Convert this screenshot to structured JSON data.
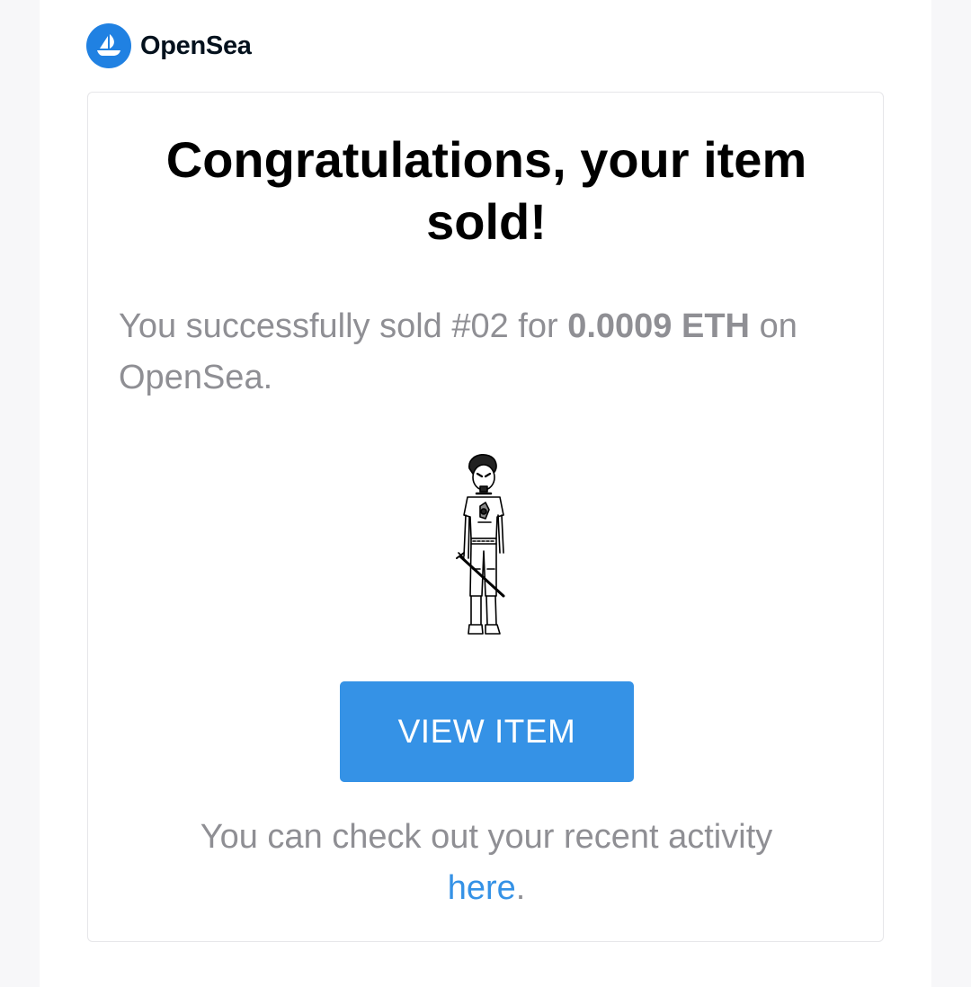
{
  "brand": {
    "name": "OpenSea",
    "logo_icon": "opensea-ship-icon",
    "color": "#2081e2"
  },
  "email": {
    "title": "Congratulations, your item sold!",
    "summary_prefix": "You successfully sold #02 for ",
    "price": "0.0009 ETH",
    "summary_suffix": " on OpenSea.",
    "item_image": "nft-character-illustration",
    "view_button_label": "VIEW ITEM",
    "activity_prefix": "You can check out your recent activity ",
    "activity_link_label": "here",
    "activity_suffix": "."
  },
  "colors": {
    "button": "#3592e6",
    "muted_text": "#8f8f94",
    "link": "#3592e6"
  }
}
